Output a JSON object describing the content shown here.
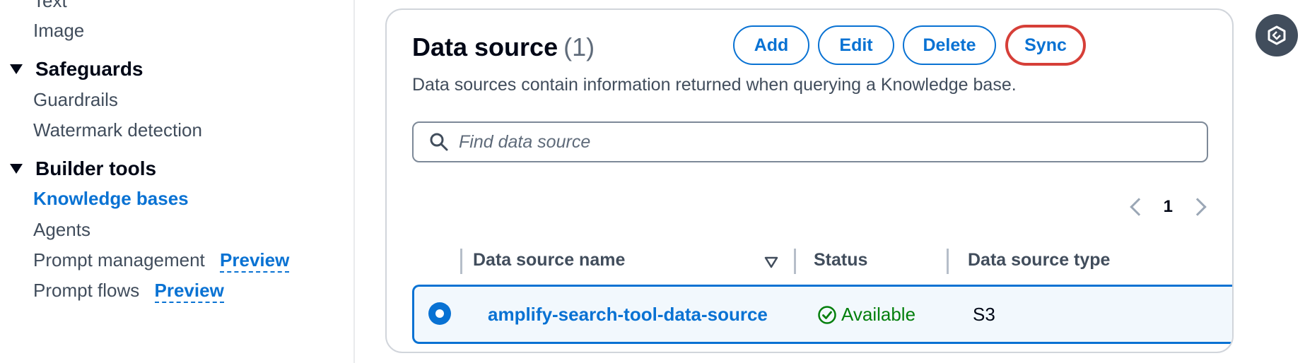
{
  "sidebar": {
    "top_partial": "Text",
    "image": "Image",
    "safeguards": {
      "heading": "Safeguards",
      "items": [
        "Guardrails",
        "Watermark detection"
      ]
    },
    "builder_tools": {
      "heading": "Builder tools",
      "items": [
        {
          "label": "Knowledge bases",
          "active": true
        },
        {
          "label": "Agents"
        },
        {
          "label": "Prompt management",
          "badge": "Preview"
        },
        {
          "label": "Prompt flows",
          "badge": "Preview"
        }
      ]
    }
  },
  "panel": {
    "title": "Data source",
    "count": "(1)",
    "description": "Data sources contain information returned when querying a Knowledge base.",
    "buttons": {
      "add": "Add",
      "edit": "Edit",
      "delete": "Delete",
      "sync": "Sync"
    },
    "search": {
      "placeholder": "Find data source",
      "value": ""
    },
    "pagination": {
      "current_page": "1"
    },
    "table": {
      "columns": [
        "Data source name",
        "Status",
        "Data source type"
      ],
      "rows": [
        {
          "name": "amplify-search-tool-data-source",
          "status": "Available",
          "type": "S3",
          "selected": true
        }
      ]
    }
  },
  "colors": {
    "accent": "#0972d3",
    "sync_highlight": "#d63f38",
    "status_success": "#037f0c",
    "text_secondary": "#414d5c"
  },
  "icons": {
    "search": "search-icon",
    "sort": "sort-down-icon",
    "status": "check-circle-icon",
    "pager_prev": "chevron-left-icon",
    "pager_next": "chevron-right-icon",
    "assistant": "assistant-icon"
  }
}
